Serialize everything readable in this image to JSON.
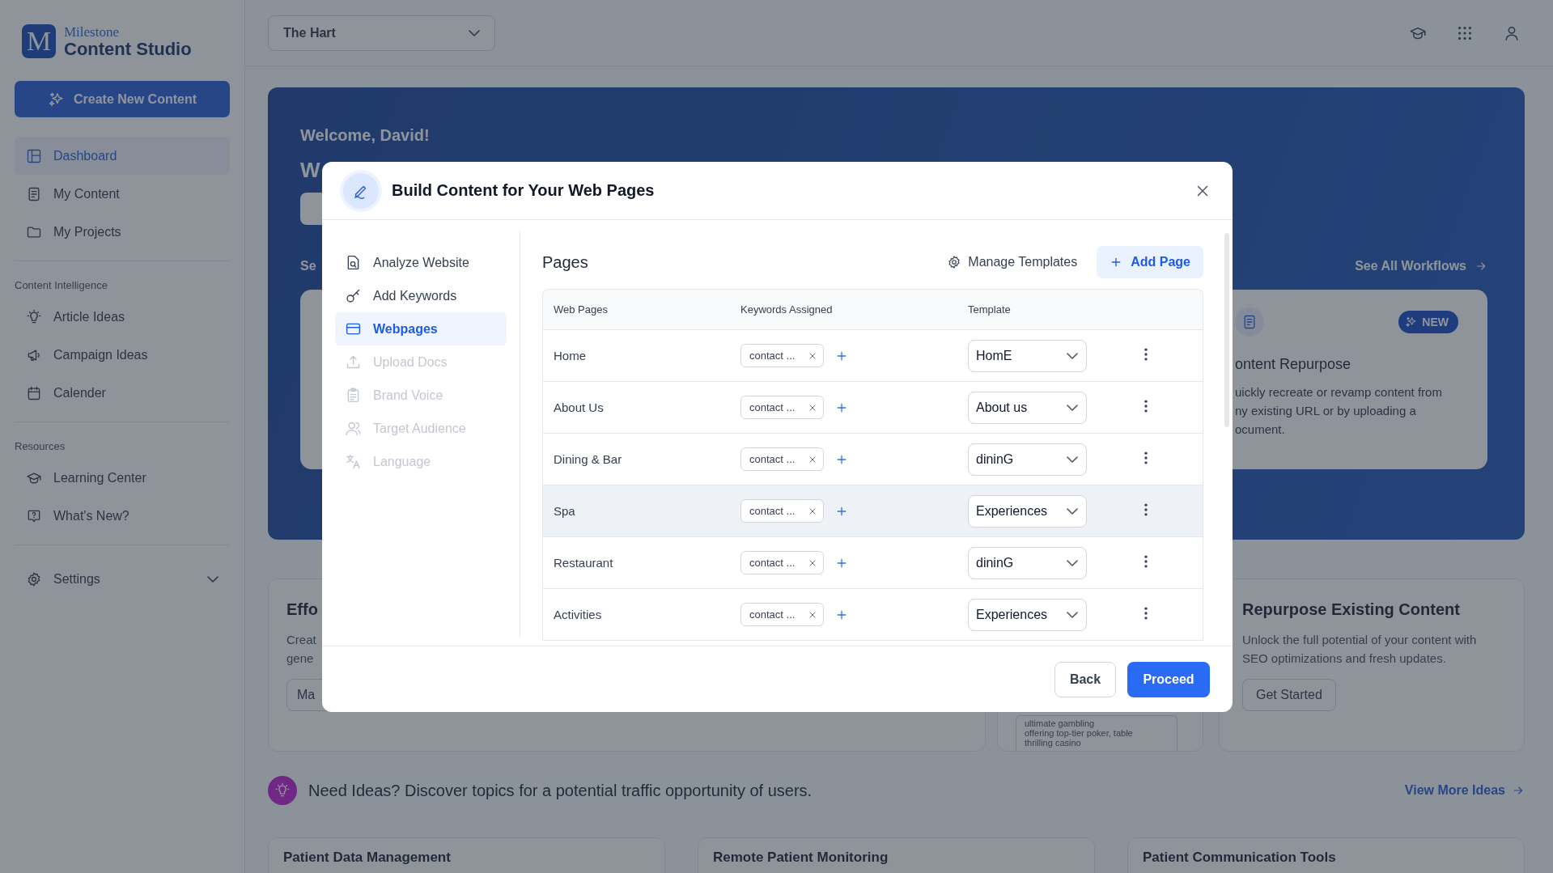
{
  "sidebar": {
    "logo": {
      "letter": "M",
      "brand": "Milestone",
      "product": "Content Studio"
    },
    "create_button": "Create New Content",
    "sections": [
      {
        "items": [
          {
            "label": "Dashboard",
            "selected": true
          },
          {
            "label": "My Content",
            "selected": false
          },
          {
            "label": "My Projects",
            "selected": false
          }
        ]
      },
      {
        "heading": "Content Intelligence",
        "items": [
          {
            "label": "Article Ideas",
            "selected": false
          },
          {
            "label": "Campaign Ideas",
            "selected": false
          },
          {
            "label": "Calender",
            "selected": false
          }
        ]
      },
      {
        "heading": "Resources",
        "items": [
          {
            "label": "Learning Center",
            "selected": false
          },
          {
            "label": "What's New?",
            "selected": false
          }
        ]
      }
    ],
    "settings": {
      "label": "Settings",
      "expanded": false
    }
  },
  "topbar": {
    "property_select": "The Hart"
  },
  "hero": {
    "greeting": "Welcome, David!",
    "heading": "W",
    "section_label": "Se",
    "link": "See All Workflows",
    "card": {
      "badge": "NEW",
      "title": "ontent Repurpose",
      "description_lines": [
        "uickly recreate or revamp content from",
        "ny existing URL or by uploading a",
        "ocument."
      ]
    }
  },
  "modal": {
    "title": "Build Content for Your Web Pages",
    "steps": [
      {
        "label": "Analyze Website",
        "selected": false,
        "disabled": false
      },
      {
        "label": "Add Keywords",
        "selected": false,
        "disabled": false
      },
      {
        "label": "Webpages",
        "selected": true,
        "disabled": false
      },
      {
        "label": "Upload Docs",
        "selected": false,
        "disabled": true
      },
      {
        "label": "Brand Voice",
        "selected": false,
        "disabled": true
      },
      {
        "label": "Target Audience",
        "selected": false,
        "disabled": true
      },
      {
        "label": "Language",
        "selected": false,
        "disabled": true
      }
    ],
    "section_title": "Pages",
    "manage_templates": "Manage Templates",
    "add_page": "Add Page",
    "columns": [
      "Web Pages",
      "Keywords Assigned",
      "Template"
    ],
    "rows": [
      {
        "page": "Home",
        "keywords": [
          "contact ..."
        ],
        "template": "HomE",
        "highlighted": false
      },
      {
        "page": "About Us",
        "keywords": [
          "contact ..."
        ],
        "template": "About us",
        "highlighted": false
      },
      {
        "page": "Dining & Bar",
        "keywords": [
          "contact ..."
        ],
        "template": "dininG",
        "highlighted": false
      },
      {
        "page": "Spa",
        "keywords": [
          "contact ..."
        ],
        "template": "Experiences",
        "highlighted": true
      },
      {
        "page": "Restaurant",
        "keywords": [
          "contact ..."
        ],
        "template": "dininG",
        "highlighted": false
      },
      {
        "page": "Activities",
        "keywords": [
          "contact ..."
        ],
        "template": "Experiences",
        "highlighted": false
      }
    ],
    "buttons": {
      "back": "Back",
      "proceed": "Proceed"
    }
  },
  "feature_cards": [
    {
      "title": "Effo",
      "description_lines": [
        "Creat",
        "gene"
      ],
      "button": "Ma"
    },
    {
      "preview_lines": [
        "ultimate gambling",
        "offering top-tier poker, table",
        "thrilling casino"
      ]
    },
    {
      "title": "Repurpose Existing Content",
      "description": "Unlock the full potential of your content with SEO optimizations and fresh updates.",
      "button": "Get Started"
    }
  ],
  "ideas": {
    "text": "Need Ideas? Discover topics for a potential traffic opportunity of users.",
    "link": "View More Ideas"
  },
  "topic_cards": [
    "Patient Data Management",
    "Remote Patient Monitoring",
    "Patient Communication Tools"
  ]
}
